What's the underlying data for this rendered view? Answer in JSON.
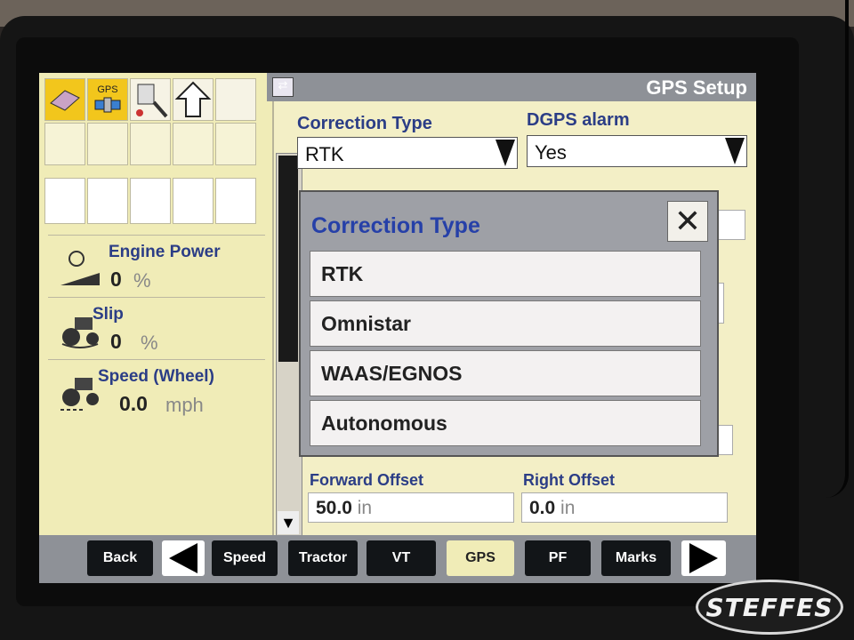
{
  "header": {
    "title": "GPS Setup"
  },
  "status_icons": {
    "gps_label": "GPS"
  },
  "readouts": [
    {
      "label": "Engine Power",
      "value": "0",
      "unit": "%"
    },
    {
      "label": "Slip",
      "value": "0",
      "unit": "%"
    },
    {
      "label": "Speed (Wheel)",
      "value": "0.0",
      "unit": "mph"
    }
  ],
  "fields": {
    "correction_type": {
      "label": "Correction Type",
      "value": "RTK"
    },
    "dgps_alarm": {
      "label": "DGPS alarm",
      "value": "Yes"
    },
    "forward_offset": {
      "label": "Forward Offset",
      "value": "50.0",
      "unit": "in"
    },
    "right_offset": {
      "label": "Right Offset",
      "value": "0.0",
      "unit": "in"
    }
  },
  "dialog": {
    "title": "Correction Type",
    "close_symbol": "✕",
    "options": [
      "RTK",
      "Omnistar",
      "WAAS/EGNOS",
      "Autonomous"
    ]
  },
  "tabs": {
    "back": "Back",
    "speed": "Speed",
    "tractor": "Tractor",
    "vt": "VT",
    "gps": "GPS",
    "pf": "PF",
    "marks": "Marks"
  },
  "watermark": "STEFFES"
}
